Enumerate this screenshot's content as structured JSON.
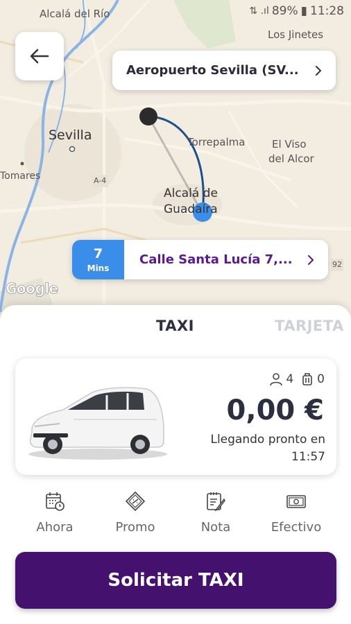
{
  "status_bar": {
    "battery": "89%",
    "time": "11:28"
  },
  "map": {
    "labels": {
      "alcala_del_rio": "Alcalá del Río",
      "los_jinetes": "Los Jinetes",
      "sevilla": "Sevilla",
      "torrepalma": "Torrepalma",
      "el_viso": "El Viso",
      "del_alcor": "del Alcor",
      "tomares": "Tomares",
      "a4": "A-4",
      "alcala_de": "Alcalá de",
      "guadaira": "Guadaíra",
      "a92": "92"
    },
    "google": "Google"
  },
  "pickup": {
    "label": "Aeropuerto Sevilla (SV..."
  },
  "destination": {
    "eta_value": "7",
    "eta_unit": "Mins",
    "label": "Calle Santa Lucía 7,..."
  },
  "tabs": [
    {
      "label": "TAXI",
      "active": true
    },
    {
      "label": "TARJETA",
      "active": false
    }
  ],
  "vehicle": {
    "passengers": "4",
    "luggage": "0",
    "price": "0,00 €",
    "eta_line1": "Llegando pronto en",
    "eta_line2": "11:57"
  },
  "options": [
    {
      "label": "Ahora",
      "icon": "calendar-clock-icon"
    },
    {
      "label": "Promo",
      "icon": "coupon-icon"
    },
    {
      "label": "Nota",
      "icon": "note-icon"
    },
    {
      "label": "Efectivo",
      "icon": "cash-icon"
    }
  ],
  "request_button": "Solicitar TAXI",
  "colors": {
    "primary": "#45116e",
    "eta_blue": "#3a8eea",
    "dest_text": "#5a1a8f",
    "route": "#1d4f8a"
  }
}
